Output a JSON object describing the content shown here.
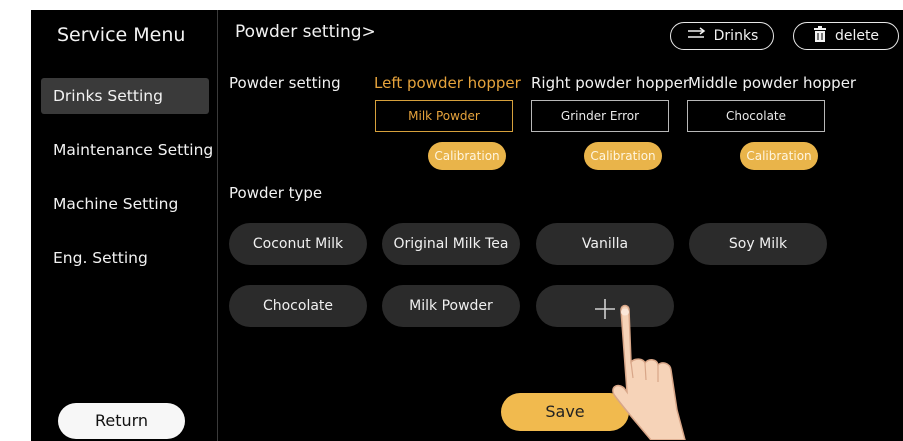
{
  "sidebar": {
    "title": "Service Menu",
    "items": [
      {
        "label": "Drinks Setting",
        "active": true
      },
      {
        "label": "Maintenance Setting",
        "active": false
      },
      {
        "label": "Machine Setting",
        "active": false
      },
      {
        "label": "Eng. Setting",
        "active": false
      }
    ],
    "return_label": "Return"
  },
  "header": {
    "title": "Powder setting>",
    "drinks_label": "Drinks",
    "drinks_icon": "swap-arrows-icon",
    "delete_label": "delete",
    "delete_icon": "trash-icon"
  },
  "powder_setting": {
    "label": "Powder setting",
    "hoppers": [
      {
        "name": "Left powder hopper",
        "value": "Milk Powder",
        "calibration_label": "Calibration",
        "selected": true
      },
      {
        "name": "Right powder hopper",
        "value": "Grinder Error",
        "calibration_label": "Calibration",
        "selected": false
      },
      {
        "name": "Middle powder hopper",
        "value": "Chocolate",
        "calibration_label": "Calibration",
        "selected": false
      }
    ]
  },
  "powder_type": {
    "label": "Powder type",
    "items": [
      "Coconut Milk",
      "Original Milk Tea",
      "Vanilla",
      "Soy Milk",
      "Chocolate",
      "Milk Powder"
    ],
    "add_icon": "plus-icon"
  },
  "save_label": "Save",
  "colors": {
    "accent": "#e9b44a",
    "selected_text": "#e6a33c",
    "chip": "#2b2b2b",
    "background": "#000000"
  }
}
